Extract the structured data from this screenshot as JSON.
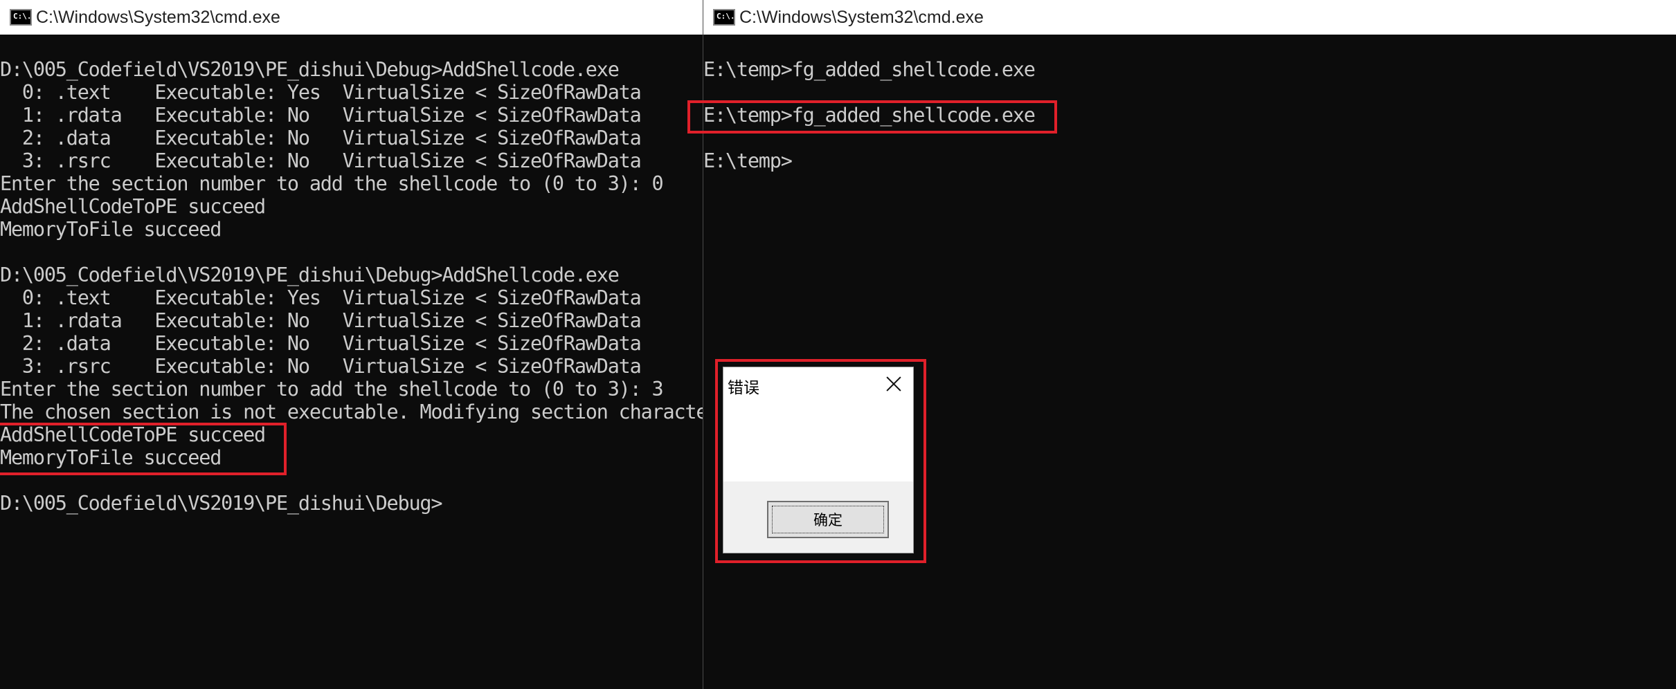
{
  "left_window": {
    "title": "C:\\Windows\\System32\\cmd.exe",
    "icon": "cmd-icon",
    "lines": [
      "D:\\005_Codefield\\VS2019\\PE_dishui\\Debug>AddShellcode.exe",
      "  0: .text    Executable: Yes  VirtualSize < SizeOfRawData",
      "  1: .rdata   Executable: No   VirtualSize < SizeOfRawData",
      "  2: .data    Executable: No   VirtualSize < SizeOfRawData",
      "  3: .rsrc    Executable: No   VirtualSize < SizeOfRawData",
      "Enter the section number to add the shellcode to (0 to 3): 0",
      "AddShellCodeToPE succeed",
      "MemoryToFile succeed",
      "",
      "D:\\005_Codefield\\VS2019\\PE_dishui\\Debug>AddShellcode.exe",
      "  0: .text    Executable: Yes  VirtualSize < SizeOfRawData",
      "  1: .rdata   Executable: No   VirtualSize < SizeOfRawData",
      "  2: .data    Executable: No   VirtualSize < SizeOfRawData",
      "  3: .rsrc    Executable: No   VirtualSize < SizeOfRawData",
      "Enter the section number to add the shellcode to (0 to 3): 3",
      "The chosen section is not executable. Modifying section characte",
      "AddShellCodeToPE succeed",
      "MemoryToFile succeed",
      "",
      "D:\\005_Codefield\\VS2019\\PE_dishui\\Debug>"
    ]
  },
  "right_window": {
    "title": "C:\\Windows\\System32\\cmd.exe",
    "icon": "cmd-icon",
    "lines": [
      "E:\\temp>fg_added_shellcode.exe",
      "",
      "E:\\temp>fg_added_shellcode.exe",
      "",
      "E:\\temp>"
    ]
  },
  "dialog": {
    "title": "错误",
    "ok_label": "确定",
    "close_icon": "close-icon"
  },
  "colors": {
    "console_bg": "#0c0c0c",
    "console_text": "#cccccc",
    "highlight": "#e0202a"
  }
}
